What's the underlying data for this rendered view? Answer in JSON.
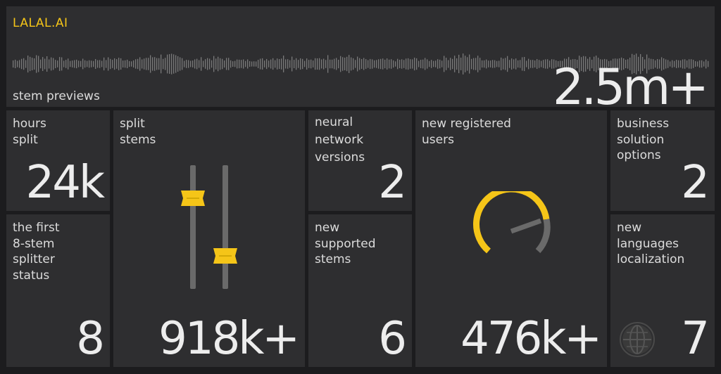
{
  "brand": "LALAL.AI",
  "stem_previews": {
    "label": "stem previews",
    "value": "2.5m+"
  },
  "hours_split": {
    "label": "hours\nsplit",
    "value": "24k"
  },
  "first_8stem": {
    "label": "the first\n8-stem\nsplitter\nstatus",
    "value": "8"
  },
  "split_stems": {
    "label": "split\nstems",
    "value": "918k+"
  },
  "neural_versions": {
    "label": "neural\nnetwork\nversions",
    "value": "2"
  },
  "new_stems": {
    "label": "new\nsupported\nstems",
    "value": "6"
  },
  "new_users": {
    "label": "new registered\nusers",
    "value": "476k+"
  },
  "business": {
    "label": "business\nsolution\noptions",
    "value": "2"
  },
  "languages": {
    "label": "new\nlanguages\nlocalization",
    "value": "7"
  },
  "colors": {
    "accent": "#f5c518",
    "card": "#2e2e30",
    "bg": "#1c1c1e"
  },
  "icons": [
    "waveform-icon",
    "fader-icon",
    "gauge-icon",
    "globe-icon"
  ]
}
